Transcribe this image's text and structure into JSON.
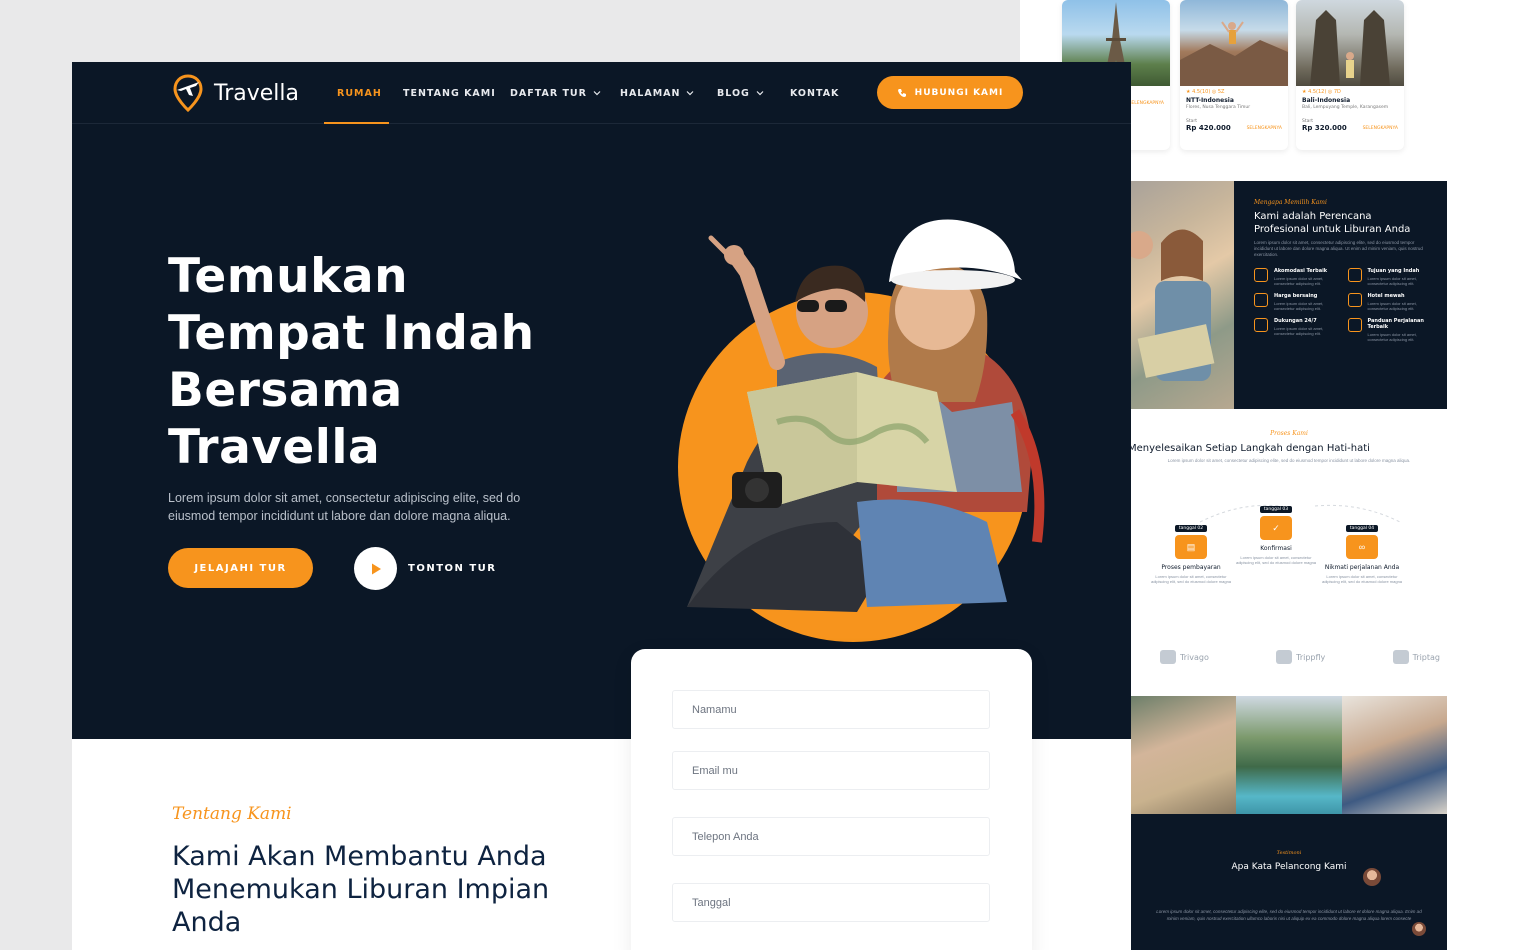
{
  "brand": {
    "name": "Travella",
    "accent": "#f7941d",
    "navy": "#0b1726"
  },
  "nav": {
    "items": [
      {
        "label": "RUMAH",
        "active": true,
        "dropdown": false
      },
      {
        "label": "TENTANG KAMI",
        "active": false,
        "dropdown": false
      },
      {
        "label": "DAFTAR TUR",
        "active": false,
        "dropdown": true
      },
      {
        "label": "HALAMAN",
        "active": false,
        "dropdown": true
      },
      {
        "label": "BLOG",
        "active": false,
        "dropdown": true
      },
      {
        "label": "KONTAK",
        "active": false,
        "dropdown": false
      }
    ],
    "cta": "HUBUNGI KAMI",
    "cta_icon": "phone-icon"
  },
  "hero": {
    "title_lines": [
      "Temukan",
      "Tempat Indah",
      "Bersama",
      "Travella"
    ],
    "description": "Lorem ipsum dolor sit amet, consectetur adipiscing elite, sed do eiusmod tempor incididunt ut labore dan dolore magna aliqua.",
    "primary_button": "JELAJAHI TUR",
    "watch_button": "TONTON TUR"
  },
  "booking_form": {
    "fields": [
      {
        "placeholder": "Namamu"
      },
      {
        "placeholder": "Email mu"
      },
      {
        "placeholder": "Telepon Anda"
      },
      {
        "placeholder": "Tanggal"
      }
    ]
  },
  "about": {
    "subtitle": "Tentang Kami",
    "title": "Kami Akan Membantu Anda Menemukan Liburan Impian Anda"
  },
  "tour_cards": [
    {
      "name": "",
      "meta": "",
      "address": "",
      "start": "",
      "price": "",
      "more": "SELENGKAPNYA"
    },
    {
      "name": "NTT-Indonesia",
      "meta": "★ 4.5(10)   ◎ 5Z",
      "address": "Flores, Nusa Tenggara Timur",
      "start": "Start",
      "price": "Rp 420.000",
      "more": "SELENGKAPNYA"
    },
    {
      "name": "Bali-Indonesia",
      "meta": "★ 4.5(12)   ◎ 7D",
      "address": "Bali, Lempuyang Temple, Karangasem",
      "start": "Start",
      "price": "Rp 320.000",
      "more": "SELENGKAPNYA"
    }
  ],
  "why_us": {
    "subtitle": "Mengapa Memilih Kami",
    "title": "Kami adalah Perencana Profesional untuk Liburan Anda",
    "description": "Lorem ipsum dolor sit amet, consectetur adipiscing elite, sed do eiusmod tempor incididunt ut labore dan dolore magna aliqua. Ut enim ad minim veniam, quis nostrud exercitation.",
    "features": [
      {
        "title": "Akomodasi Terbaik",
        "desc": "Lorem ipsum dolor sit amet, consectetur adipiscing elit."
      },
      {
        "title": "Tujuan yang Indah",
        "desc": "Lorem ipsum dolor sit amet, consectetur adipiscing elit."
      },
      {
        "title": "Harga bersaing",
        "desc": "Lorem ipsum dolor sit amet, consectetur adipiscing elit."
      },
      {
        "title": "Hotel mewah",
        "desc": "Lorem ipsum dolor sit amet, consectetur adipiscing elit."
      },
      {
        "title": "Dukungan 24/7",
        "desc": "Lorem ipsum dolor sit amet, consectetur adipiscing elit."
      },
      {
        "title": "Panduan Perjalanan Terbaik",
        "desc": "Lorem ipsum dolor sit amet, consectetur adipiscing elit."
      }
    ]
  },
  "process": {
    "subtitle": "Proses Kami",
    "title": "Menyelesaikan Setiap Langkah dengan Hati-hati",
    "description": "Lorem ipsum dolor sit amet, consectetur adipiscing elite, sed do eiusmod tempor incididunt ut labore dolore magna aliqua.",
    "steps": [
      {
        "tag": "tanggal 02",
        "title": "Proses pembayaran",
        "desc": "Lorem ipsum dolor sit amet, consectetur adipiscing elit, sed do eiusmod dolore magna"
      },
      {
        "tag": "tanggal 03",
        "title": "Konfirmasi",
        "desc": "Lorem ipsum dolor sit amet, consectetur adipiscing elit, sed do eiusmod dolore magna"
      },
      {
        "tag": "tanggal 04",
        "title": "Nikmati perjalanan Anda",
        "desc": "Lorem ipsum dolor sit amet, consectetur adipiscing elit, sed do eiusmod dolore magna"
      }
    ]
  },
  "partners": [
    {
      "name": "Trivago"
    },
    {
      "name": "Trippfly"
    },
    {
      "name": "Triptag"
    }
  ],
  "testimonial": {
    "subtitle": "Testimoni",
    "title": "Apa Kata Pelancong Kami",
    "quote": "Lorem ipsum dolor sit amet, consectetur adipiscing elite, sed do eiusmod tempor incididunt ut labore et dolore magna aliqua. Enim ad minim veniam, quis nostrud exercitation ullamco laboris nisi ut aliquip ex ea commodo dolore magna aliqua lorem consecte"
  }
}
